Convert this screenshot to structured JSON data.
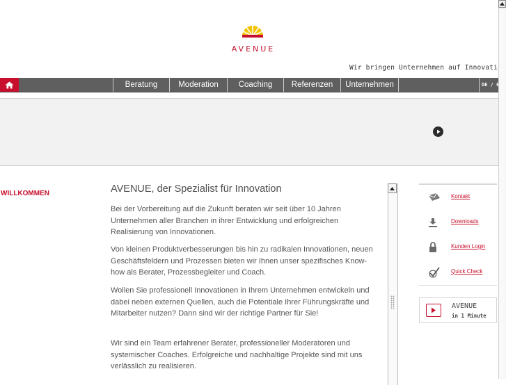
{
  "header": {
    "logo_text": "AVENUE",
    "tagline": "Wir bringen Unternehmen auf Innovationsku"
  },
  "nav": {
    "home_icon": "home-icon",
    "items": [
      {
        "label": "Beratung"
      },
      {
        "label": "Moderation"
      },
      {
        "label": "Coaching"
      },
      {
        "label": "Referenzen"
      },
      {
        "label": "Unternehmen"
      }
    ],
    "language": "DE / E"
  },
  "hero": {
    "play_icon": "play-icon"
  },
  "section_label": "WILLKOMMEN",
  "content": {
    "title": "AVENUE, der Spezialist für Innovation",
    "paragraphs": [
      "Bei der Vorbereitung auf die Zukunft beraten wir seit über 10 Jahren Unternehmen aller Branchen in ihrer Entwicklung und erfolgreichen Realisierung von Innovationen.",
      "Von kleinen Produktverbesserungen bis hin zu radikalen Innovationen, neuen Geschäftsfeldern und Prozessen bieten wir Ihnen unser spezifisches Know-how als Berater, Prozessbegleiter und Coach.",
      "Wollen Sie professionell Innovationen in Ihrem Unternehmen entwickeln und dabei neben externen Quellen, auch die Potentiale Ihrer Führungskräfte und Mitarbeiter nutzen? Dann sind wir der richtige Partner für Sie!",
      "Wir sind ein Team erfahrener Berater, professioneller Moderatoren und systemischer Coaches. Erfolgreiche und nachhaltige Projekte sind mit uns verlässlich zu realisieren."
    ]
  },
  "sidebar": {
    "items": [
      {
        "label": "Kontakt",
        "icon": "envelope-icon"
      },
      {
        "label": "Downloads",
        "icon": "download-icon"
      },
      {
        "label": "Kunden Login",
        "icon": "lock-icon"
      },
      {
        "label": "Quick Check",
        "icon": "checkmark-icon"
      }
    ],
    "video": {
      "line1": "AVENUE",
      "line2": "in 1 Minute",
      "icon": "play-icon"
    }
  },
  "colors": {
    "brand_red": "#c8102e",
    "nav_gray": "#5f5f5f",
    "logo_yellow": "#f2c200"
  }
}
